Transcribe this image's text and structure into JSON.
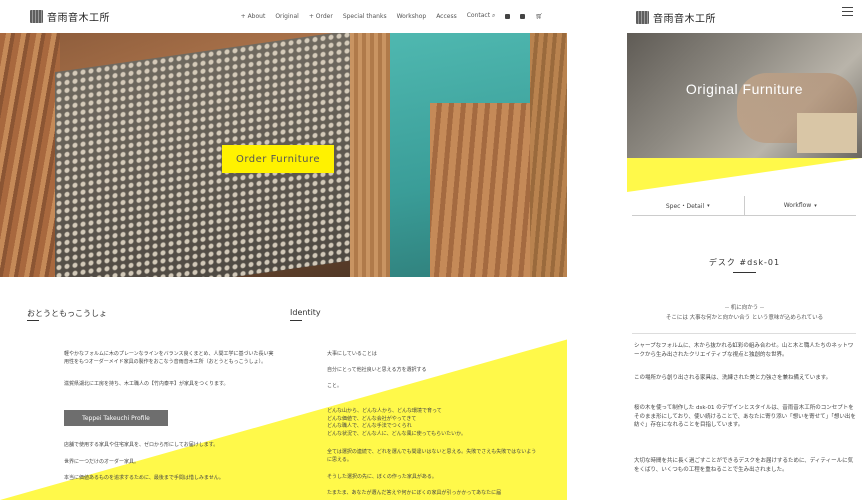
{
  "desktop": {
    "logo_text": "音雨音木工所",
    "nav": [
      "+ About",
      "Original",
      "+ Order",
      "Special thanks",
      "Workshop",
      "Access",
      "Contact"
    ],
    "social_icons": [
      "facebook-icon",
      "instagram-icon",
      "cart-icon"
    ],
    "hero_button": "Order Furniture",
    "section_left_title": "おとうともっこうしょ",
    "section_right_title": "Identity",
    "left_p1": "軽やかなフォルムに木のプレーンなラインをバランス良くまとめ、人間工学に基づいた長い実用性をもつオーダーメイド家具の製作をおこなう音雨音木工所（おとうともっこうしょ）。",
    "left_p2": "滋賀県湖北に工房を持ち、木工職人の【竹内泰平】が家具をつくります。",
    "profile_button": "Teppei Takeuchi Profile",
    "left_p3": "店舗で使用する家具や住宅家具を、ゼロから形にしてお届けします。",
    "left_p4": "世界に一つだけのオーダー家具。",
    "left_p5": "本当に価値あるものを追求するために、最後まで手間は惜しみません。",
    "right_p1": "大事にしていることは",
    "right_p2": "自分にとって他社良いと思える方を選択する",
    "right_p3": "こと。",
    "right_p4": "どんな山から、どんな人から、どんな環境で育って\nどんな価値で、どんな会社がやってきて\nどんな職人で、どんな手法でつくられ\nどんな状況で、どんな人に、どんな風に使ってもらいたいか。",
    "right_p5": "全ては選択の連続で、どれを選んでも間違いはないと思える。失敗でさえも失敗ではないように思える。",
    "right_p6": "そうした選択の先に、ぼくの作った家具がある。",
    "right_p7": "たまたま、あなたが選んだ答えや何かにぼくの家具が引っかかってあなたに届"
  },
  "mobile": {
    "logo_text": "音雨音木工所",
    "hero_title": "Original Furniture",
    "tabs": [
      {
        "label": "Spec・Detail",
        "caret": "▾"
      },
      {
        "label": "Workflow",
        "caret": "▾"
      }
    ],
    "product_title": "デスク #dsk-01",
    "quote_line1": "-- 机に向かう --",
    "quote_line2": "そこには 大事な何かと向かい合う という意味が込められている",
    "p1": "シャープなフォルムに、木から抜かれる虹彩の組み合わせ。山と木と職人たちのネットワークから生み出されたクリエイティブな視点と独創的な世界。",
    "p2": "この場所から創り出される家具は、洗練された美と力強さを兼ね備えています。",
    "p3": "桜の木を使って制作した dsk-01 のデザインとスタイルは、音雨音木工所のコンセプトをそのまま形にしており、使い続けることで、あなたに寄り添い「想いを寄せて」「想い出を紡ぐ」存在になれることを目指しています。",
    "p4": "大切な時間を共に長く過ごすことができるデスクをお届けするために、ディティールに気をくばり、いくつもの工程を重ねることで生み出されました。"
  },
  "colors": {
    "accent_yellow": "#fff200",
    "diagonal_yellow": "#fff94a",
    "teal": "#3a9d98"
  }
}
